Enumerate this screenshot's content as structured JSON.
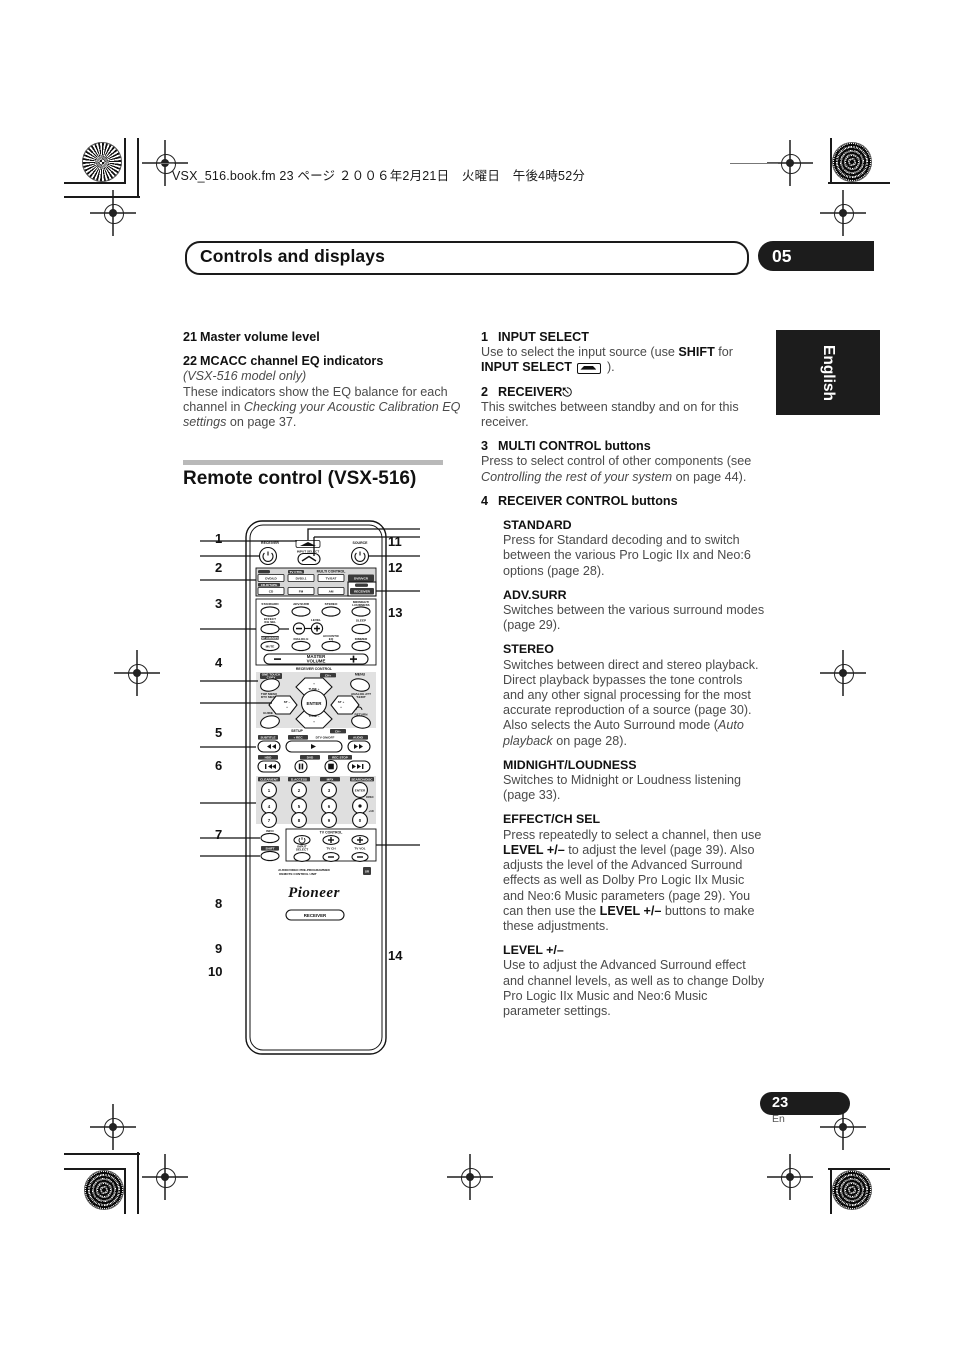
{
  "printhead": {
    "filename_line": "VSX_516.book.fm 23 ページ ２００６年2月21日　火曜日　午後4時52分"
  },
  "chapter": {
    "title": "Controls and displays",
    "number": "05"
  },
  "side_tab": {
    "label": "English"
  },
  "page_footer": {
    "number": "23",
    "language": "En"
  },
  "left_column": {
    "items": [
      {
        "num": "21",
        "title": "Master volume level"
      },
      {
        "num": "22",
        "title": "MCACC channel EQ indicators",
        "italic_note": "(VSX-516 model only)",
        "body_1": "These indicators show the EQ balance for each channel in ",
        "body_italic": "Checking your Acoustic Calibration EQ settings",
        "body_2": " on page 37."
      }
    ],
    "section_title": "Remote control (VSX-516)"
  },
  "right_column": {
    "items": [
      {
        "num": "1",
        "title": "INPUT SELECT",
        "body_pre": "Use to select the input source (use ",
        "body_bold1": "SHIFT",
        "body_mid": " for ",
        "body_bold2": "INPUT SELECT",
        "body_icon": "input-select-icon",
        "body_post": " )."
      },
      {
        "num": "2",
        "title": "RECEIVER",
        "title_icon": "power-icon",
        "body": "This switches between standby and on for this receiver."
      },
      {
        "num": "3",
        "title": "MULTI CONTROL buttons",
        "body_pre": "Press to select control of other components (see ",
        "body_italic": "Controlling the rest of your system",
        "body_post": " on page 44)."
      },
      {
        "num": "4",
        "title": "RECEIVER CONTROL buttons"
      }
    ],
    "sub_items": [
      {
        "title": "STANDARD",
        "body": "Press for Standard decoding and to switch between the various Pro Logic IIx and Neo:6 options (page 28)."
      },
      {
        "title": "ADV.SURR",
        "body": "Switches between the various surround modes (page 29)."
      },
      {
        "title": "STEREO",
        "body_1": "Switches between direct and stereo playback. Direct playback bypasses the tone controls and any other signal processing for the most accurate reproduction of a source (page 30). Also selects the Auto Surround mode (",
        "body_italic": "Auto playback",
        "body_2": " on page 28)."
      },
      {
        "title": "MIDNIGHT/LOUDNESS",
        "body": "Switches to Midnight or Loudness listening (page 33)."
      },
      {
        "title": "EFFECT/CH SEL",
        "body_1": "Press repeatedly to select a channel, then use ",
        "bold_1": "LEVEL +/–",
        "body_2": " to adjust the level (page 39). Also adjusts the level of the Advanced Surround effects as well as Dolby Pro Logic IIx Music and Neo:6 Music parameters (page 29). You can then use the ",
        "bold_2": "LEVEL +/–",
        "body_3": " buttons to make these adjustments."
      },
      {
        "title": "LEVEL +/–",
        "body": "Use to adjust the Advanced Surround effect and channel levels, as well as to change Dolby Pro Logic IIx Music and Neo:6 Music parameter settings."
      }
    ]
  },
  "remote": {
    "callouts_left": [
      "1",
      "2",
      "3",
      "4",
      "5",
      "6",
      "7",
      "8",
      "9",
      "10"
    ],
    "callouts_right": [
      "11",
      "12",
      "13",
      "14"
    ],
    "labels": {
      "receiver": "RECEIVER",
      "source": "SOURCE",
      "input_select": "INPUT SELECT",
      "multi_control": "MULTI CONTROL",
      "multi_row1": [
        "DVD/LD",
        "DVD5.1",
        "TV/SAT",
        "DVR/VCR"
      ],
      "multi_row1_tags": [
        "",
        "TV CTRL",
        "",
        ""
      ],
      "multi_row2": [
        "CD",
        "FM",
        "AM",
        "RECEIVER"
      ],
      "multi_row2_tags": [
        "CD-R/TAPE",
        "",
        "",
        ""
      ],
      "mode_row": [
        "STANDARD",
        "ADV.SURR",
        "STEREO",
        "MIDNIGHT/ LOUDNESS"
      ],
      "effect_ch_sel": "EFFECT /CH SEL",
      "level": "LEVEL",
      "sleep": "SLEEP",
      "mute": "MUTE",
      "mute_tag": "SP A/B/MPX",
      "dialog_e": "DIALOG E",
      "acoustic_eq": "ACOUSTIC EQ",
      "dimmer": "DIMMER",
      "master_volume": "MASTER VOLUME",
      "receiver_control": "RECEIVER CONTROL",
      "one_touch_copy": "ONE TOUCH COPY",
      "ch_plus": "CH+",
      "menu": "MENU",
      "top_menu": "TOP MENU DTV MENU",
      "analog_att": "ANALOG ATT T.EDIT",
      "tune_plus": "TUNE +",
      "tune_minus": "TUNE –",
      "st_minus": "ST –",
      "st_plus": "ST +",
      "enter": "ENTER",
      "guide": "GUIDE",
      "setup": "SETUP",
      "return": "RETURN",
      "ch_minus": "CH–",
      "transport_tags_1": [
        "SUBTITLE",
        "+ REC",
        "DTV ON/OFF",
        "AUDIO"
      ],
      "transport_tags_2": [
        "HDD",
        "DVD",
        "REC STOP"
      ],
      "num_tags": [
        "CLEAR/ENT",
        "D.ACCESS",
        "MPX",
        "SEARCH/DISC"
      ],
      "numbers": [
        "1",
        "2",
        "3",
        "ENTER",
        "4",
        "5",
        "6",
        "•",
        "7",
        "8",
        "9",
        "0"
      ],
      "disc": "DISC",
      "info": "INFO",
      "shift": "SHIFT",
      "tv_control": "TV CONTROL",
      "tv_input_select": "INPUT SELECT",
      "tv_ch": "TV CH",
      "tv_vol": "TV VOL",
      "footer_line1": "AUDIO/VIDEO PRE-PROGRAMMED",
      "footer_line2": "REMOTE CONTROL UNIT",
      "brand": "Pioneer",
      "bottom_badge": "RECEIVER"
    }
  }
}
